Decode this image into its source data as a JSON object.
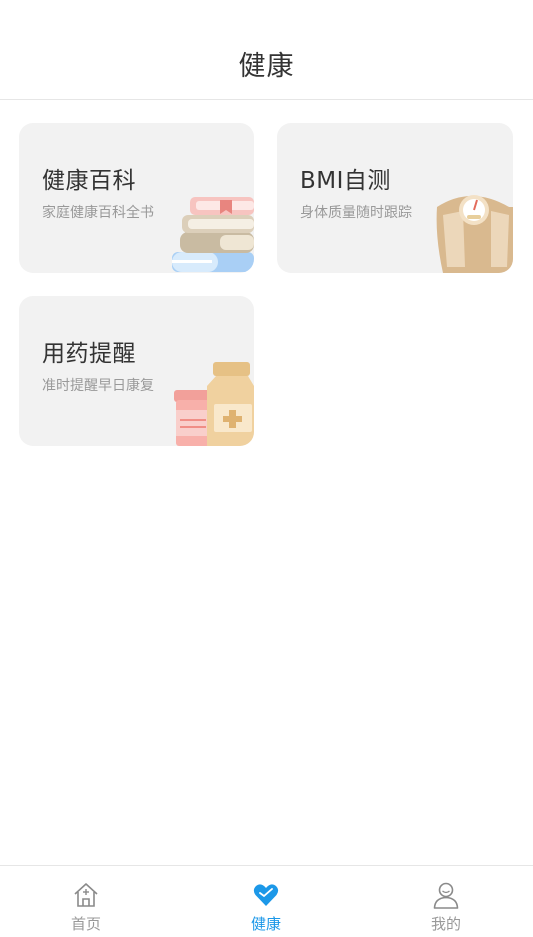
{
  "header": {
    "title": "健康"
  },
  "cards": [
    {
      "title": "健康百科",
      "subtitle": "家庭健康百科全书",
      "illustration": "books-icon"
    },
    {
      "title": "BMI自测",
      "subtitle": "身体质量随时跟踪",
      "illustration": "scale-icon"
    },
    {
      "title": "用药提醒",
      "subtitle": "准时提醒早日康复",
      "illustration": "medicine-bottle-icon"
    }
  ],
  "tabbar": {
    "items": [
      {
        "label": "首页",
        "icon": "home-icon",
        "active": false
      },
      {
        "label": "健康",
        "icon": "heart-icon",
        "active": true
      },
      {
        "label": "我的",
        "icon": "user-icon",
        "active": false
      }
    ]
  },
  "colors": {
    "accent": "#1c98e8",
    "card_bg": "#f2f2f2",
    "inactive": "#999999"
  }
}
